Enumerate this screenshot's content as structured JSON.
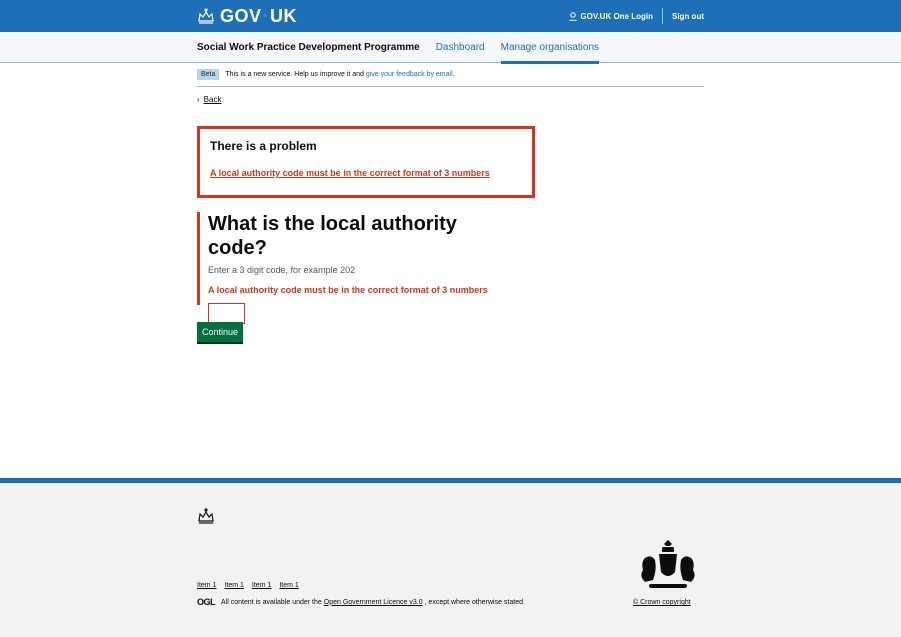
{
  "header": {
    "logo_text": "GOV",
    "logo_text2": "UK",
    "login_label": "GOV.UK One Login",
    "signout_label": "Sign out"
  },
  "service_nav": {
    "service_name": "Social Work Practice Development Programme",
    "items": [
      {
        "label": "Dashboard",
        "active": false
      },
      {
        "label": "Manage organisations",
        "active": true
      }
    ]
  },
  "phase_banner": {
    "tag": "Beta",
    "text": "This is a new service. Help us improve it and",
    "link": "give your feedback by email",
    "suffix": "."
  },
  "back_link": "Back",
  "error_summary": {
    "title": "There is a problem",
    "error": "A local authority code must be in the correct format of 3 numbers"
  },
  "form": {
    "heading": "What is the local authority code?",
    "hint": "Enter a 3 digit code, for example 202",
    "error": "A local authority code must be in the correct format of 3 numbers",
    "value": ""
  },
  "continue_label": "Continue",
  "footer": {
    "links": [
      "Item 1",
      "Item 1",
      "Item 1",
      "Item 1"
    ],
    "ogl": "OGL",
    "licence_prefix": "All content is available under the",
    "licence_link": "Open Government Licence v3.0",
    "licence_suffix": ", except where otherwise stated",
    "copyright": "© Crown copyright"
  },
  "colors": {
    "brand": "#1d70b8",
    "error": "#d4351c",
    "button": "#00703c"
  }
}
